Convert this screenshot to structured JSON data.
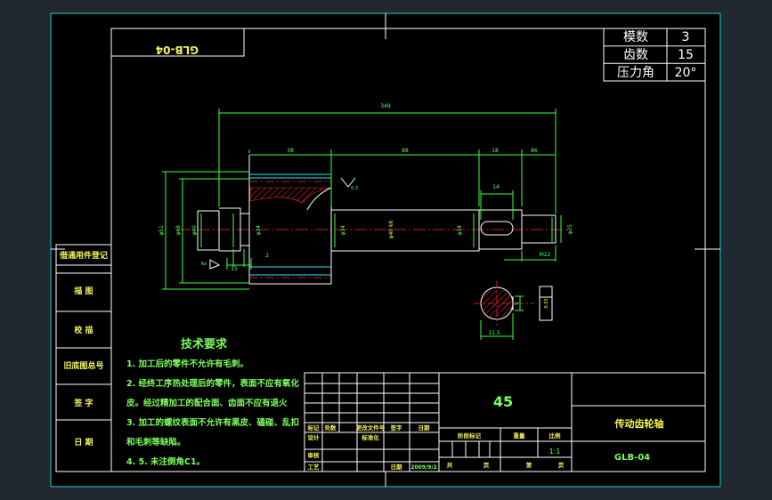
{
  "drawing_no_mirrored": "GLB-04",
  "params": [
    {
      "label": "模数",
      "value": "3"
    },
    {
      "label": "齿数",
      "value": "15"
    },
    {
      "label": "压力角",
      "value": "20°"
    }
  ],
  "dims": {
    "total_length": "349",
    "seg1": "38",
    "seg2": "88",
    "seg3": "18",
    "seg4": "86",
    "key_length": "14",
    "left_step": "15",
    "small_two": "2",
    "keyway_depth": "11.5",
    "keyway_width": "6",
    "surface_finish": "6.3"
  },
  "left_labels": [
    "借通用件登记",
    "描 图",
    "校 描",
    "旧底图总号",
    "签 字",
    "日 期"
  ],
  "tech_req": {
    "title": "技术要求",
    "lines": [
      "1. 加工后的零件不允许有毛刺。",
      "2. 经终工序热处理后的零件，表面不应有氧化",
      "   皮。经过精加工的配合面、齿面不应有退火",
      "3. 加工的螺纹表面不允许有黑皮、磕碰、乱扣",
      "   和毛刺等缺陷。",
      "4. 5. 未注倒角C1。"
    ]
  },
  "title_block": {
    "material": "45",
    "part_name": "传动齿轮轴",
    "drawing_no": "GLB-04",
    "scale": "1:1",
    "date": "2009/9/2",
    "headers": [
      "标记",
      "处数",
      "更改文件号",
      "签字",
      "日期"
    ],
    "roles": [
      "设计",
      "标准化",
      "审核",
      "工艺",
      "日期"
    ],
    "stage_headers": [
      "阶段标记",
      "重量",
      "比例"
    ],
    "sheet_labels": [
      "共",
      "页",
      "第",
      "页"
    ]
  }
}
